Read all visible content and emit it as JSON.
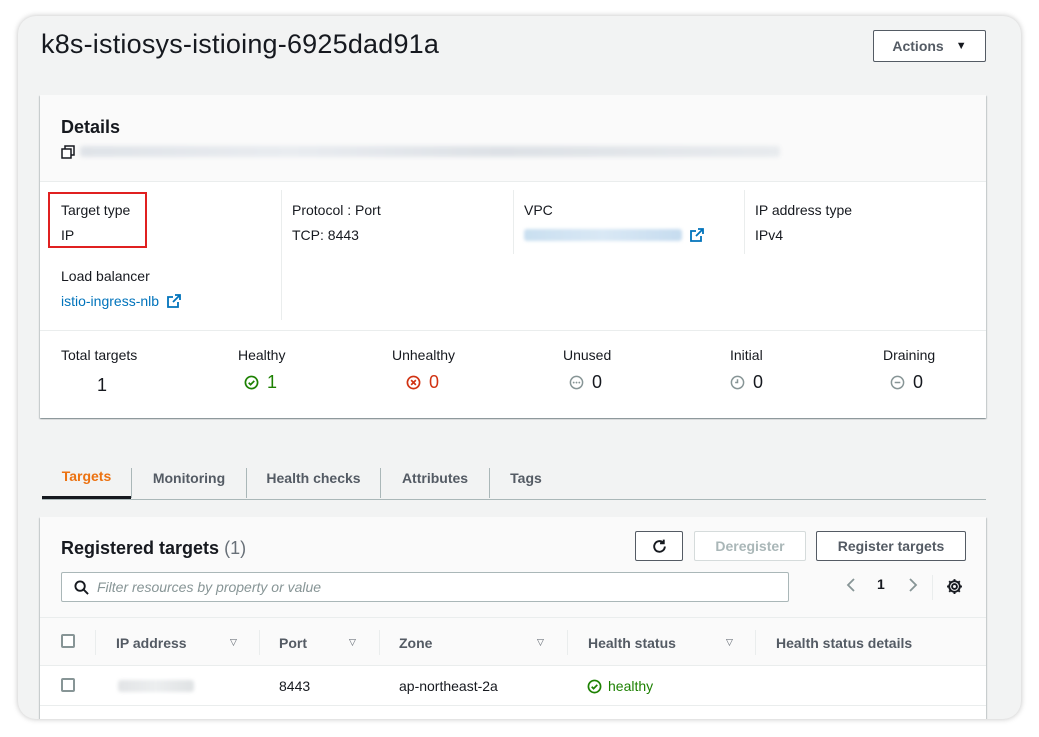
{
  "header": {
    "title": "k8s-istiosys-istioing-6925dad91a",
    "actions_label": "Actions"
  },
  "details": {
    "title": "Details",
    "target_type_label": "Target type",
    "target_type_value": "IP",
    "protocol_label": "Protocol : Port",
    "protocol_value": "TCP: 8443",
    "vpc_label": "VPC",
    "ip_type_label": "IP address type",
    "ip_type_value": "IPv4",
    "lb_label": "Load balancer",
    "lb_value": "istio-ingress-nlb"
  },
  "stats": {
    "total_label": "Total targets",
    "total_value": "1",
    "healthy_label": "Healthy",
    "healthy_value": "1",
    "unhealthy_label": "Unhealthy",
    "unhealthy_value": "0",
    "unused_label": "Unused",
    "unused_value": "0",
    "initial_label": "Initial",
    "initial_value": "0",
    "draining_label": "Draining",
    "draining_value": "0"
  },
  "tabs": [
    {
      "label": "Targets"
    },
    {
      "label": "Monitoring"
    },
    {
      "label": "Health checks"
    },
    {
      "label": "Attributes"
    },
    {
      "label": "Tags"
    }
  ],
  "targets": {
    "title": "Registered targets",
    "count": "(1)",
    "deregister_label": "Deregister",
    "register_label": "Register targets",
    "search_placeholder": "Filter resources by property or value",
    "page_number": "1",
    "columns": {
      "ip": "IP address",
      "port": "Port",
      "zone": "Zone",
      "health": "Health status",
      "health_details": "Health status details"
    },
    "rows": [
      {
        "port": "8443",
        "zone": "ap-northeast-2a",
        "health": "healthy"
      }
    ]
  },
  "colors": {
    "link": "#0073bb",
    "active_tab": "#ec7211",
    "healthy": "#1d8102",
    "unhealthy": "#d13212",
    "highlight_box": "#e02020"
  }
}
